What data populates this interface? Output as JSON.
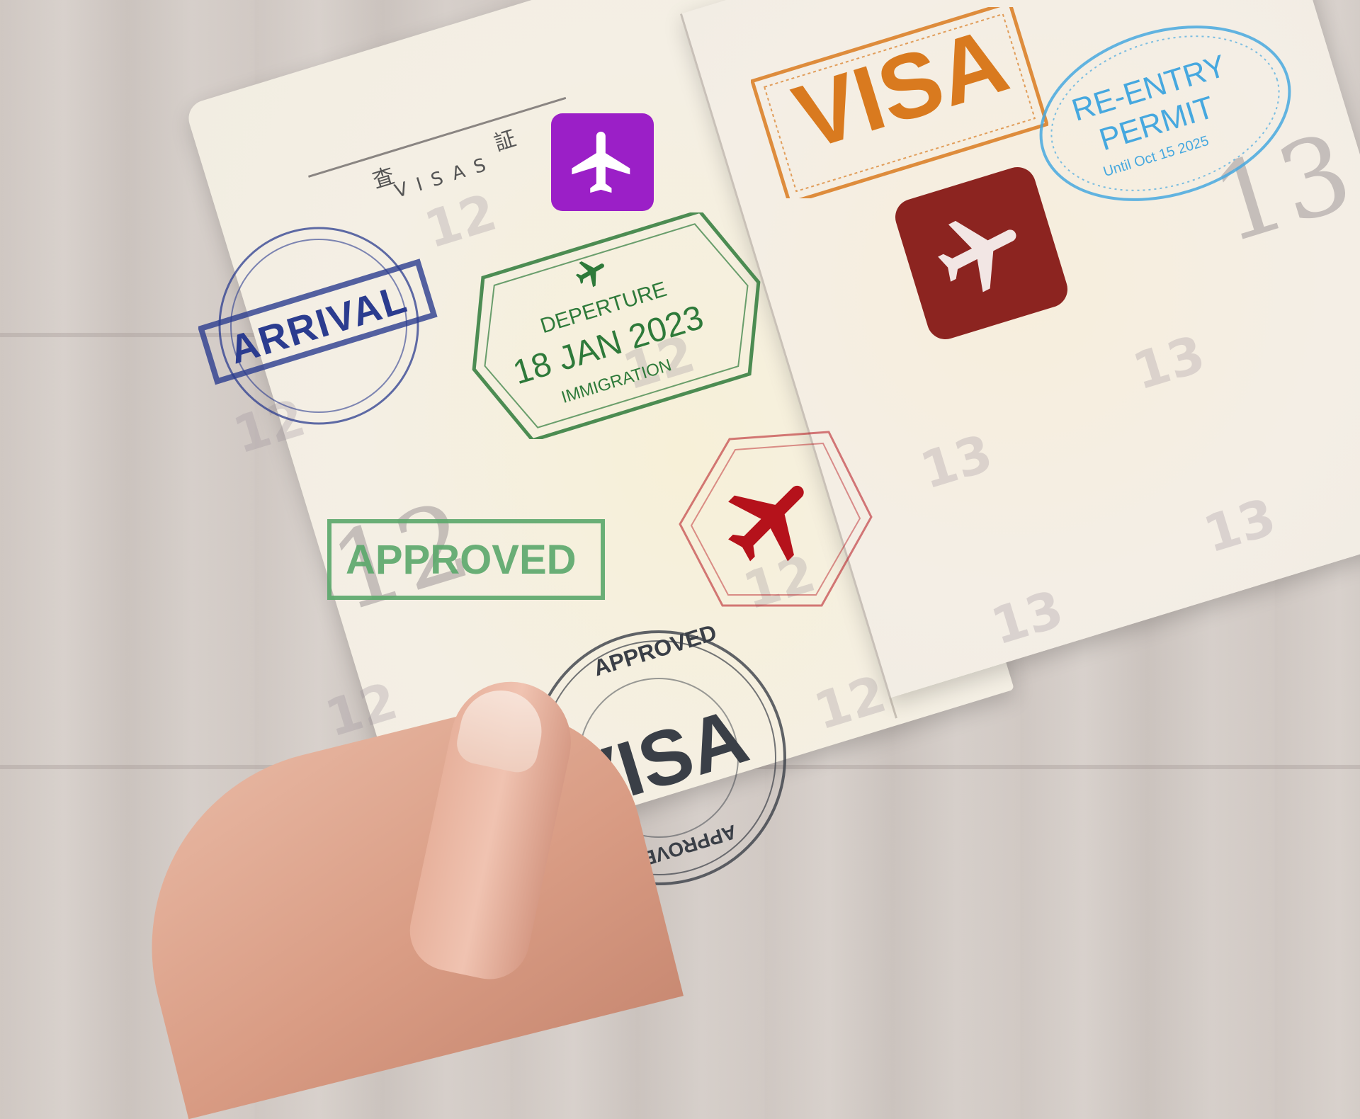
{
  "passport": {
    "header_cjk": "査 証",
    "header_en": "VISAS",
    "left_page_number": "12",
    "right_page_number": "13"
  },
  "stamps": {
    "arrival": {
      "label": "ARRIVAL",
      "color": "#2b3c8f"
    },
    "departure": {
      "top_label": "DEPERTURE",
      "date": "18 JAN 2023",
      "bottom_label": "IMMIGRATION",
      "color": "#2e7a3a"
    },
    "approved_green": {
      "label": "APPROVED",
      "color": "#5aa86b"
    },
    "visa_round": {
      "top_label": "APPROVED",
      "center_label": "VISA",
      "bottom_label": "APPROVED",
      "color": "#3a3f47"
    },
    "visa_orange": {
      "label": "VISA",
      "color": "#d97a1f"
    },
    "reentry": {
      "line1": "RE-ENTRY",
      "line2": "PERMIT",
      "until": "Until Oct 15 2025",
      "color": "#46a8df"
    },
    "plane_purple": {
      "icon": "airplane-icon",
      "color": "#9b1fc7"
    },
    "plane_red_hex": {
      "icon": "airplane-icon",
      "color": "#b5121b"
    },
    "plane_maroon": {
      "icon": "airplane-icon",
      "color": "#8c2420"
    }
  }
}
